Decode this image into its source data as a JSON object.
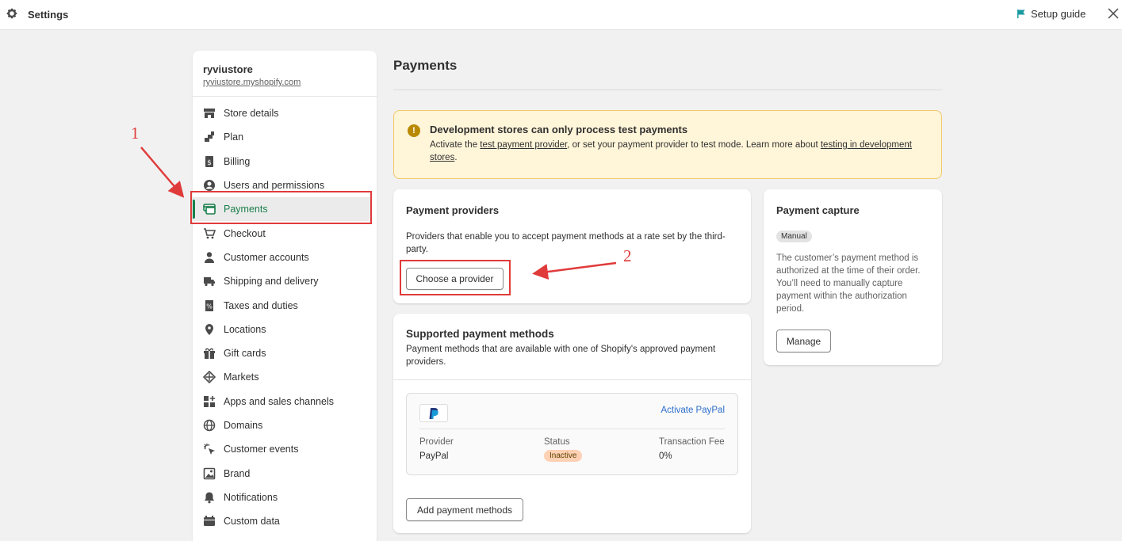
{
  "topbar": {
    "title": "Settings",
    "setup_guide": "Setup guide"
  },
  "store": {
    "name": "ryviustore",
    "url": "ryviustore.myshopify.com"
  },
  "sidebar": {
    "items": [
      {
        "label": "Store details",
        "icon": "store-icon"
      },
      {
        "label": "Plan",
        "icon": "plan-icon"
      },
      {
        "label": "Billing",
        "icon": "billing-icon"
      },
      {
        "label": "Users and permissions",
        "icon": "user-circle-icon"
      },
      {
        "label": "Payments",
        "icon": "payments-icon",
        "active": true
      },
      {
        "label": "Checkout",
        "icon": "cart-icon"
      },
      {
        "label": "Customer accounts",
        "icon": "person-icon"
      },
      {
        "label": "Shipping and delivery",
        "icon": "truck-icon"
      },
      {
        "label": "Taxes and duties",
        "icon": "tax-icon"
      },
      {
        "label": "Locations",
        "icon": "location-pin-icon"
      },
      {
        "label": "Gift cards",
        "icon": "gift-icon"
      },
      {
        "label": "Markets",
        "icon": "globe-icon"
      },
      {
        "label": "Apps and sales channels",
        "icon": "apps-icon"
      },
      {
        "label": "Domains",
        "icon": "domain-globe-icon"
      },
      {
        "label": "Customer events",
        "icon": "cursor-icon"
      },
      {
        "label": "Brand",
        "icon": "brand-icon"
      },
      {
        "label": "Notifications",
        "icon": "bell-icon"
      },
      {
        "label": "Custom data",
        "icon": "data-icon"
      }
    ]
  },
  "main": {
    "title": "Payments",
    "banner": {
      "title": "Development stores can only process test payments",
      "text_1": "Activate the ",
      "link_1": "test payment provider",
      "text_2": ", or set your payment provider to test mode. Learn more about ",
      "link_2": "testing in development stores",
      "text_3": "."
    },
    "providers": {
      "title": "Payment providers",
      "description": "Providers that enable you to accept payment methods at a rate set by the third-party.",
      "button": "Choose a provider"
    },
    "capture": {
      "title": "Payment capture",
      "badge": "Manual",
      "description": "The customer’s payment method is authorized at the time of their order. You’ll need to manually capture payment within the authorization period.",
      "button": "Manage"
    },
    "methods": {
      "title": "Supported payment methods",
      "description": "Payment methods that are available with one of Shopify's approved payment providers.",
      "paypal": {
        "activate": "Activate PayPal",
        "provider_label": "Provider",
        "provider_value": "PayPal",
        "status_label": "Status",
        "status_value": "Inactive",
        "fee_label": "Transaction Fee",
        "fee_value": "0%"
      },
      "button": "Add payment methods"
    }
  },
  "annotations": {
    "step_1": "1",
    "step_2": "2",
    "color": "#e03b3b"
  },
  "colors": {
    "accent_green": "#1a7f4b",
    "link_blue": "#2c6ecb",
    "banner_bg": "#fff5d9"
  }
}
